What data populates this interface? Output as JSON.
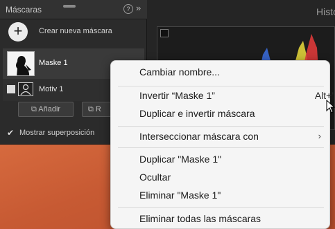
{
  "panel": {
    "title": "Máscaras",
    "create_label": "Crear nueva máscara",
    "create_symbol": "+",
    "help_symbol": "?",
    "collapse_symbol": "»",
    "masks": [
      {
        "label": "Maske 1"
      }
    ],
    "components": [
      {
        "label": "Motiv 1"
      }
    ],
    "add_label": "Añadir",
    "subtract_label": "R",
    "overlay_label": "Mostrar superposición",
    "overlay_check": "✔",
    "overlay_checked": true
  },
  "histogram": {
    "title": "Histo"
  },
  "context_menu": {
    "items": {
      "rename": "Cambiar nombre...",
      "invert": "Invertir “Maske 1”",
      "invert_shortcut": "Alt+'",
      "duplicate_invert": "Duplicar e invertir máscara",
      "intersect": "Interseccionar máscara con",
      "intersect_arrow": "›",
      "duplicate": "Duplicar \"Maske 1\"",
      "hide": "Ocultar",
      "delete": "Eliminar \"Maske 1\"",
      "delete_all": "Eliminar todas las máscaras"
    }
  },
  "colors": {
    "menu_bg": "#f5f5f5",
    "panel_bg": "#2b2b2b",
    "photo": "#c75a33"
  }
}
